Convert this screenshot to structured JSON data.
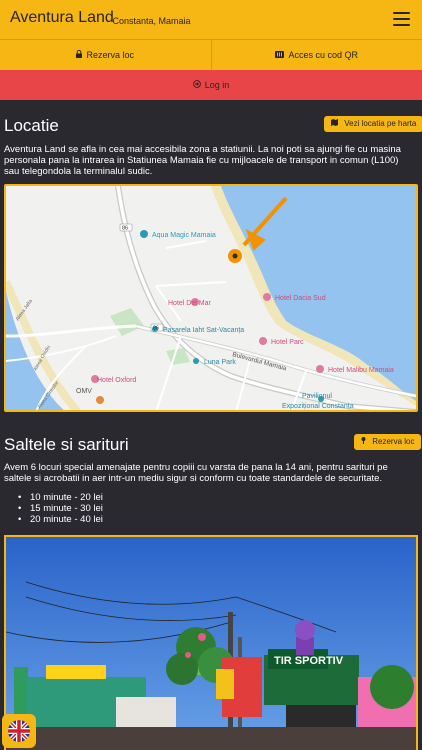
{
  "header": {
    "title": "Aventura Land",
    "subtitle": "- Constanta, Mamaia",
    "menu_icon": "hamburger-menu-icon"
  },
  "actions": {
    "reserve": {
      "icon": "lock-icon",
      "label": "Rezerva loc"
    },
    "qr": {
      "icon": "qr-ticket-icon",
      "label": "Acces cu cod QR"
    }
  },
  "login": {
    "icon": "login-icon",
    "label": "Log in"
  },
  "location": {
    "heading": "Locatie",
    "map_button": "Vezi locatia pe harta",
    "description": "Aventura Land se afla in cea mai accesibila zona a statiunii. La noi poti sa ajungi fie cu masina personala pana la intrarea in Statiunea Mamaia fie cu mijloacele de transport in comun (L100) sau telegondola la terminalul sudic.",
    "map_labels": {
      "aqua": "Aqua Magic Mamaia",
      "del_mar": "Hotel Del Mar",
      "dacia": "Hotel Dacia Sud",
      "pasarela": "Pasarela Iaht Sat-Vacanța",
      "parc": "Hotel Parc",
      "bulevard": "Bulevardul Mamaia",
      "luna": "Luna Park",
      "malibu": "Hotel Malibu Mamaia",
      "oxford": "Hotel Oxford",
      "pavilion_1": "Pavilionul",
      "pavilion_2": "Expozițional Constanța",
      "omv": "OMV",
      "road": "86",
      "ovidiu": "Aleea Ovidiu",
      "jalta": "Aleea Jalta",
      "ciresilor": "Aleea Ciresilor"
    }
  },
  "trampolines": {
    "heading": "Saltele si sarituri",
    "reserve_button": "Rezerva loc",
    "description": "Avem 6 locuri special amenajate pentru copiii cu varsta de pana la 14 ani, pentru sarituri pe saltele si acrobatii in aer intr-un mediu sigur si conform cu toate standardele de securitate.",
    "prices": [
      "10 minute - 20 lei",
      "15 minute - 30 lei",
      "20 minute - 40 lei"
    ],
    "photo_sign": "TIR SPORTIV"
  },
  "language": {
    "icon": "uk-flag-icon"
  },
  "colors": {
    "accent": "#f6b614",
    "login_bg": "#e84548",
    "page_bg": "#2b2930"
  }
}
